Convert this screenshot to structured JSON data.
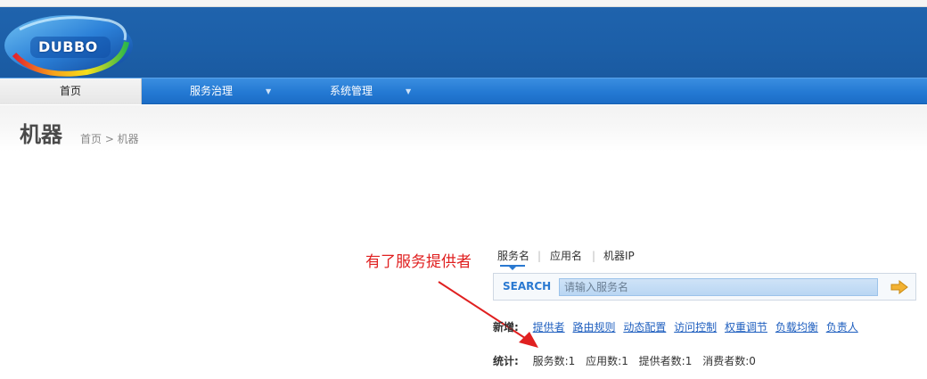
{
  "brand": {
    "logo_text": "DUBBO"
  },
  "nav": {
    "home_label": "首页",
    "governance_label": "服务治理",
    "system_label": "系统管理",
    "caret": "▼"
  },
  "page": {
    "title": "机器",
    "breadcrumb": "首页 > 机器"
  },
  "annotation": {
    "text": "有了服务提供者"
  },
  "search": {
    "tabs": [
      {
        "label": "服务名"
      },
      {
        "label": "应用名"
      },
      {
        "label": "机器IP"
      }
    ],
    "separator": "|",
    "label": "SEARCH",
    "placeholder": "请输入服务名"
  },
  "new_section": {
    "label": "新增:",
    "links": [
      "提供者",
      "路由规则",
      "动态配置",
      "访问控制",
      "权重调节",
      "负载均衡",
      "负责人"
    ]
  },
  "stats_section": {
    "label": "统计:",
    "items": [
      "服务数:1",
      "应用数:1",
      "提供者数:1",
      "消费者数:0"
    ]
  },
  "colors": {
    "header_blue": "#1c5fa8",
    "nav_blue": "#2479d3",
    "link_blue": "#1f5fbf",
    "annotation_red": "#e02020",
    "search_arrow": "#f2b233"
  }
}
